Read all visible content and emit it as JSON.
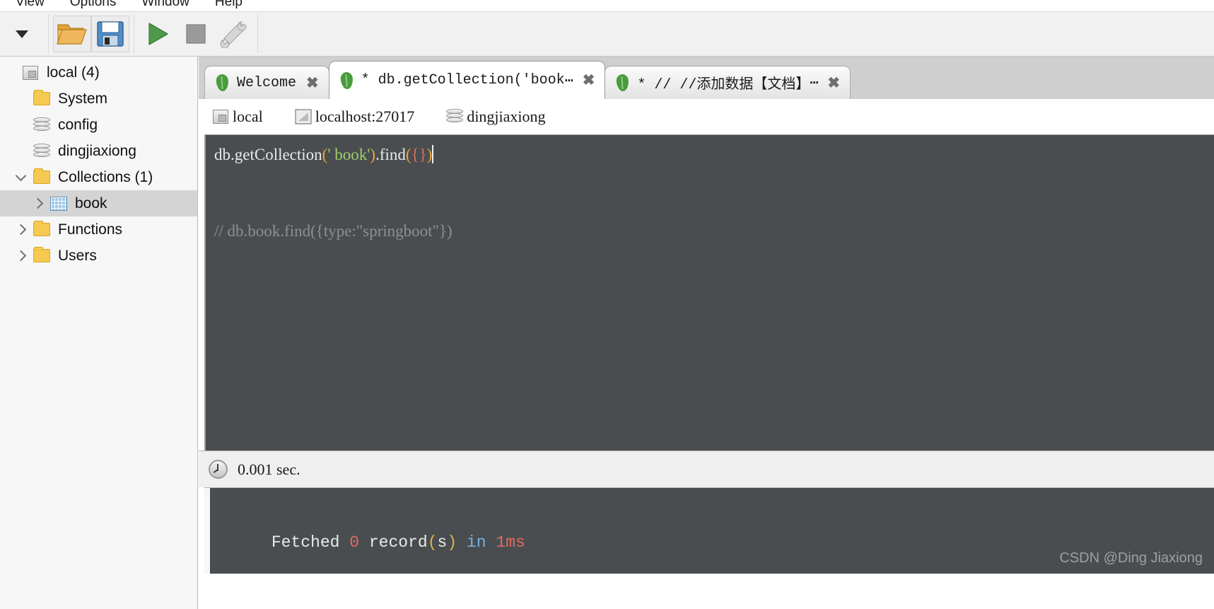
{
  "menu": {
    "items": [
      {
        "label": "View"
      },
      {
        "label": "Options"
      },
      {
        "label": "Window"
      },
      {
        "label": "Help"
      }
    ]
  },
  "toolbar": {
    "dropdown_name": "chevron-down-icon",
    "open_label": "Open",
    "save_label": "Save",
    "run_label": "Execute",
    "stop_label": "Stop",
    "tools_label": "Tools"
  },
  "sidebar": {
    "items": [
      {
        "label": "local (4)",
        "icon": "server-icon",
        "indent": 0,
        "twisty": "none",
        "selected": false
      },
      {
        "label": "System",
        "icon": "folder-icon",
        "indent": 1,
        "twisty": "none",
        "selected": false
      },
      {
        "label": "config",
        "icon": "database-icon",
        "indent": 1,
        "twisty": "none",
        "selected": false
      },
      {
        "label": "dingjiaxiong",
        "icon": "database-icon",
        "indent": 1,
        "twisty": "none",
        "selected": false
      },
      {
        "label": "Collections (1)",
        "icon": "folder-icon",
        "indent": 1,
        "twisty": "down",
        "selected": false
      },
      {
        "label": "book",
        "icon": "collection-icon",
        "indent": 2,
        "twisty": "right",
        "selected": true
      },
      {
        "label": "Functions",
        "icon": "folder-icon",
        "indent": 1,
        "twisty": "right",
        "selected": false
      },
      {
        "label": "Users",
        "icon": "folder-icon",
        "indent": 1,
        "twisty": "right",
        "selected": false
      }
    ]
  },
  "tabs": [
    {
      "label": "Welcome",
      "active": false,
      "ellipsis": false,
      "close": "✖"
    },
    {
      "label": "* db.getCollection('book",
      "active": true,
      "ellipsis": true,
      "close": "✖"
    },
    {
      "label": "* // //添加数据【文档】",
      "active": false,
      "ellipsis": true,
      "close": "✖"
    }
  ],
  "connection": {
    "server": "local",
    "host": "localhost:27017",
    "database": "dingjiaxiong"
  },
  "editor": {
    "line1": {
      "t1": "db.getCollection",
      "t2": "(",
      "t3": "' book'",
      "t4": ")",
      "t5": ".find",
      "t6": "(",
      "t7": "{}",
      "t8": ")"
    },
    "comment": "// db.book.find({type:\"springboot\"})"
  },
  "status": {
    "time": "0.001 sec.",
    "clock_icon": "clock-icon"
  },
  "results": {
    "prefix": "Fetched ",
    "count": "0",
    "record_word": " record",
    "open_paren": "(",
    "s_letter": "s",
    "close_paren": ")",
    "in_word": " in ",
    "duration": "1ms"
  },
  "watermark": {
    "text": "CSDN @Ding Jiaxiong"
  },
  "colors": {
    "editor_bg": "#494d50",
    "accent_green": "#4a9b3c",
    "selection": "#d4d4d4",
    "string": "#9fce6a",
    "paren": "#e8a33d",
    "brace": "#e06c5e"
  }
}
